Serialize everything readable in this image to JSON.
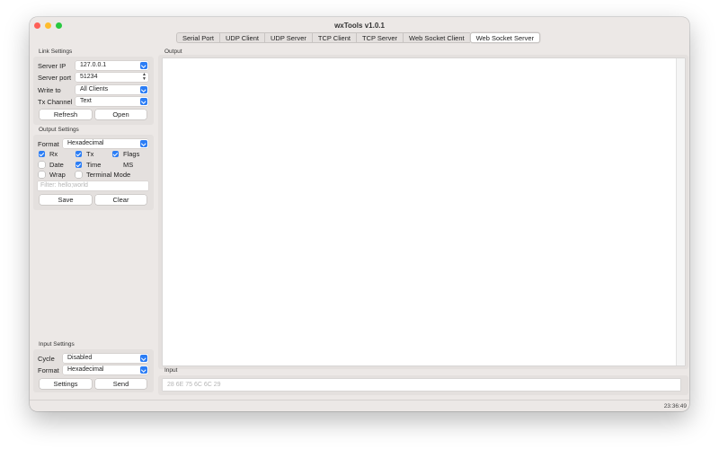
{
  "window": {
    "title": "wxTools v1.0.1"
  },
  "tabs": [
    {
      "label": "Serial Port"
    },
    {
      "label": "UDP Client"
    },
    {
      "label": "UDP Server"
    },
    {
      "label": "TCP Client"
    },
    {
      "label": "TCP Server"
    },
    {
      "label": "Web Socket Client"
    },
    {
      "label": "Web Socket Server",
      "active": true
    }
  ],
  "link_settings": {
    "title": "Link Settings",
    "server_ip": {
      "label": "Server IP",
      "value": "127.0.0.1"
    },
    "server_port": {
      "label": "Server port",
      "value": "51234"
    },
    "write_to": {
      "label": "Write to",
      "value": "All Clients"
    },
    "tx_channel": {
      "label": "Tx Channel",
      "value": "Text"
    },
    "refresh_label": "Refresh",
    "open_label": "Open"
  },
  "output_settings": {
    "title": "Output Settings",
    "format": {
      "label": "Format",
      "value": "Hexadecimal"
    },
    "checks": {
      "rx": {
        "label": "Rx",
        "checked": true
      },
      "tx": {
        "label": "Tx",
        "checked": true
      },
      "flags": {
        "label": "Flags",
        "checked": true
      },
      "date": {
        "label": "Date",
        "checked": false
      },
      "time": {
        "label": "Time",
        "checked": true
      },
      "ms": {
        "label": "MS",
        "checked": false
      },
      "wrap": {
        "label": "Wrap",
        "checked": false
      },
      "terminal": {
        "label": "Terminal Mode",
        "checked": false
      }
    },
    "filter_placeholder": "Filter: hello;world",
    "save_label": "Save",
    "clear_label": "Clear"
  },
  "input_settings": {
    "title": "Input Settings",
    "cycle": {
      "label": "Cycle",
      "value": "Disabled"
    },
    "format": {
      "label": "Format",
      "value": "Hexadecimal"
    },
    "settings_label": "Settings",
    "send_label": "Send"
  },
  "output_panel": {
    "title": "Output"
  },
  "input_panel": {
    "title": "Input",
    "placeholder": "28 6E 75 6C 6C 29"
  },
  "status": {
    "time": "23:36:49"
  },
  "colors": {
    "accent": "#2b7df5",
    "window_bg": "#ece8e6",
    "close": "#fe5f57",
    "minimize": "#febc2e",
    "maximize": "#28c840"
  }
}
